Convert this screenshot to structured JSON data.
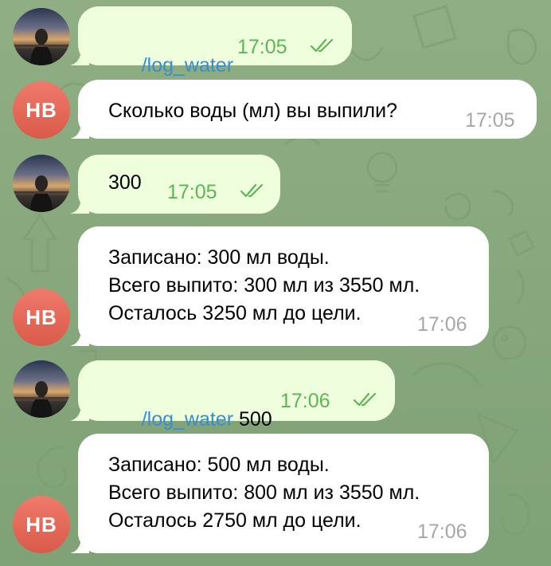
{
  "chat": {
    "messages": [
      {
        "direction": "out",
        "command": "/log_water",
        "text": "",
        "time": "17:05",
        "status_icon": "double-check-icon"
      },
      {
        "direction": "in",
        "avatar_initials": "НВ",
        "text": "Сколько воды (мл) вы выпили?",
        "time": "17:05"
      },
      {
        "direction": "out",
        "text": "300",
        "time": "17:05",
        "status_icon": "double-check-icon"
      },
      {
        "direction": "in",
        "avatar_initials": "НВ",
        "lines": [
          "Записано: 300 мл воды.",
          "Всего выпито: 300 мл из 3550 мл.",
          "Осталось 3250 мл до цели."
        ],
        "time": "17:06"
      },
      {
        "direction": "out",
        "command": "/log_water",
        "text": " 500",
        "time": "17:06",
        "status_icon": "double-check-icon"
      },
      {
        "direction": "in",
        "avatar_initials": "НВ",
        "lines": [
          "Записано: 500 мл воды.",
          "Всего выпито: 800 мл из 3550 мл.",
          "Осталось 2750 мл до цели."
        ],
        "time": "17:06"
      }
    ]
  },
  "colors": {
    "background": "#87a77d",
    "outgoing_bubble": "#effedd",
    "incoming_bubble": "#ffffff",
    "command_link": "#3a8ed0",
    "outgoing_time": "#5db655",
    "incoming_time": "#a4a7aa",
    "bot_avatar": "#e4685a"
  }
}
